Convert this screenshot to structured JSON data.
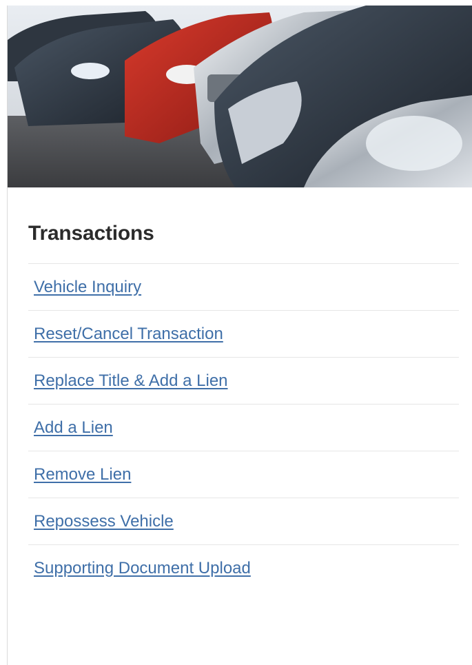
{
  "hero": {
    "image_description_icon": "car-lot-image"
  },
  "section": {
    "title": "Transactions"
  },
  "links": [
    {
      "label": "Vehicle Inquiry"
    },
    {
      "label": "Reset/Cancel Transaction"
    },
    {
      "label": "Replace Title & Add a Lien"
    },
    {
      "label": "Add a Lien"
    },
    {
      "label": "Remove Lien"
    },
    {
      "label": "Repossess Vehicle"
    },
    {
      "label": "Supporting Document Upload"
    }
  ],
  "colors": {
    "link": "#3f6fa8",
    "title": "#2b2b2b",
    "divider": "#e6e6e6"
  }
}
